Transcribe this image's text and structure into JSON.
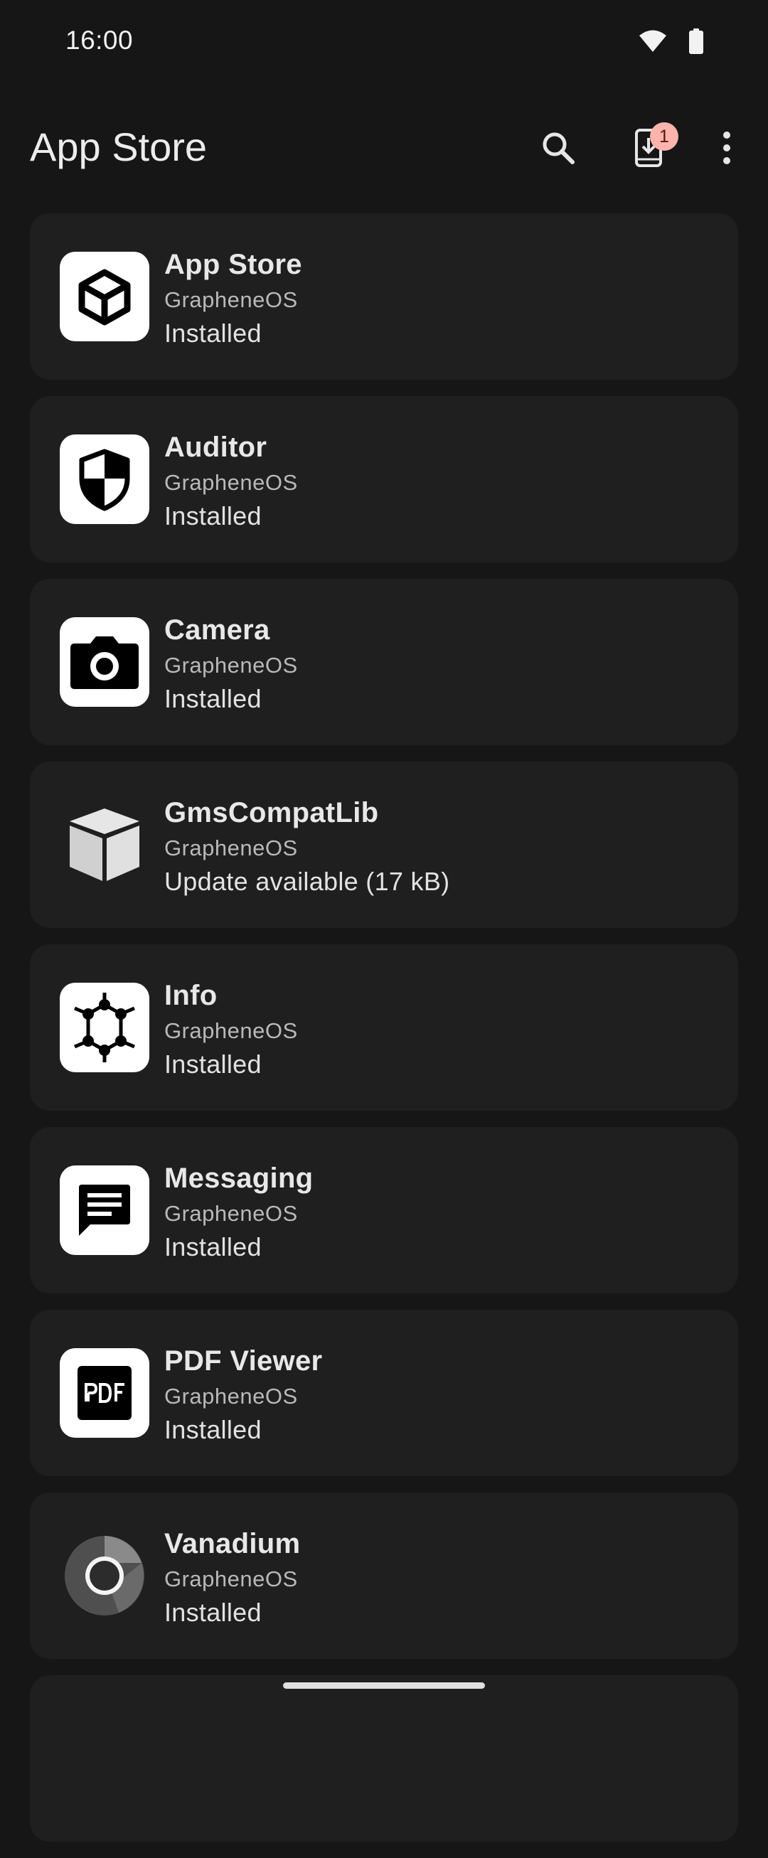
{
  "status_bar": {
    "time": "16:00",
    "icons": [
      "wifi-icon",
      "battery-icon"
    ]
  },
  "top_bar": {
    "title": "App Store",
    "actions": [
      "search-icon",
      "download-icon",
      "more-vert-icon"
    ],
    "download_badge": "1"
  },
  "colors": {
    "background": "#161616",
    "card": "#1f1f1f",
    "badge": "#ffb3ad"
  },
  "apps": [
    {
      "name": "App Store",
      "developer": "GrapheneOS",
      "status": "Installed",
      "icon": "cube-icon"
    },
    {
      "name": "Auditor",
      "developer": "GrapheneOS",
      "status": "Installed",
      "icon": "shield-icon"
    },
    {
      "name": "Camera",
      "developer": "GrapheneOS",
      "status": "Installed",
      "icon": "camera-icon"
    },
    {
      "name": "GmsCompatLib",
      "developer": "GrapheneOS",
      "status": "Update available (17 kB)",
      "icon": "package-icon"
    },
    {
      "name": "Info",
      "developer": "GrapheneOS",
      "status": "Installed",
      "icon": "hexagon-icon"
    },
    {
      "name": "Messaging",
      "developer": "GrapheneOS",
      "status": "Installed",
      "icon": "message-icon"
    },
    {
      "name": "PDF Viewer",
      "developer": "GrapheneOS",
      "status": "Installed",
      "icon": "pdf-icon"
    },
    {
      "name": "Vanadium",
      "developer": "GrapheneOS",
      "status": "Installed",
      "icon": "browser-icon"
    }
  ]
}
